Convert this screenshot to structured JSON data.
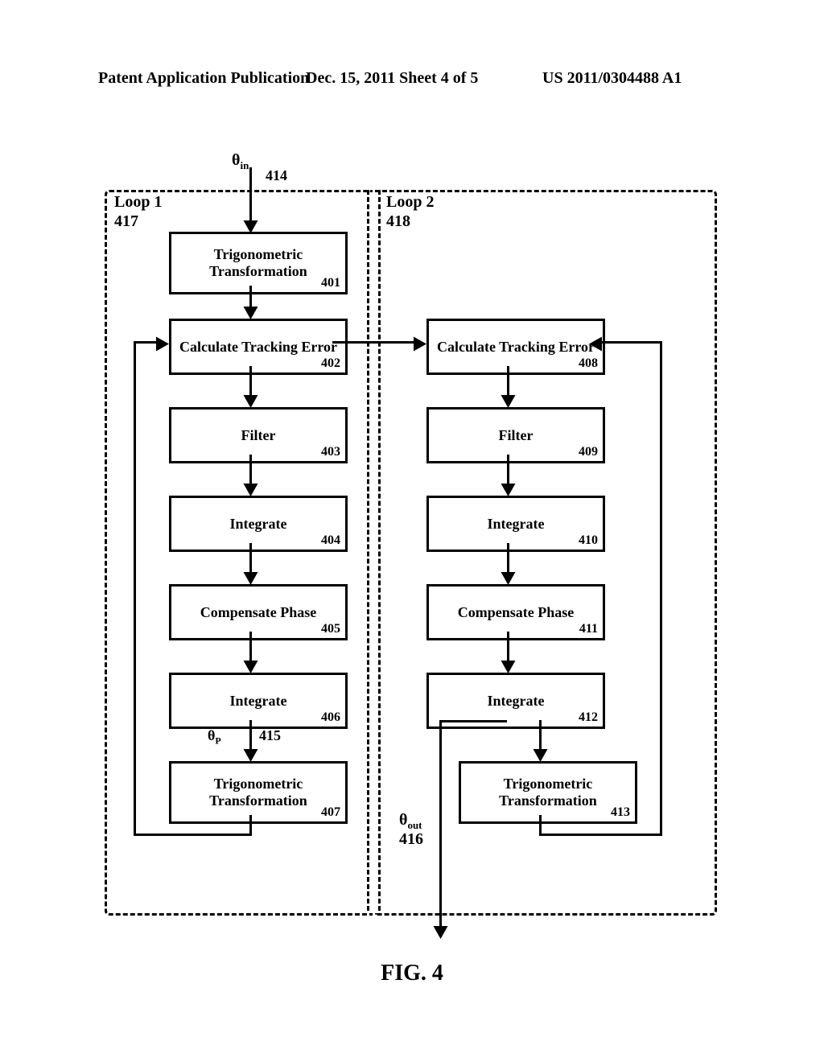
{
  "header": {
    "left": "Patent Application Publication",
    "center": "Dec. 15, 2011  Sheet 4 of 5",
    "right": "US 2011/0304488 A1"
  },
  "figure_caption": "FIG. 4",
  "diagram": {
    "input_label": "θ",
    "input_sub": "in",
    "input_ref": "414",
    "output_label": "θ",
    "output_sub": "out",
    "output_ref": "416",
    "mid_label": "θ",
    "mid_sub": "P",
    "mid_ref": "415",
    "loop1": {
      "title": "Loop 1",
      "ref": "417"
    },
    "loop2": {
      "title": "Loop 2",
      "ref": "418"
    },
    "blocks": {
      "b401": {
        "text": "Trigonometric Transformation",
        "ref": "401"
      },
      "b402": {
        "text": "Calculate Tracking Error",
        "ref": "402"
      },
      "b403": {
        "text": "Filter",
        "ref": "403"
      },
      "b404": {
        "text": "Integrate",
        "ref": "404"
      },
      "b405": {
        "text": "Compensate Phase",
        "ref": "405"
      },
      "b406": {
        "text": "Integrate",
        "ref": "406"
      },
      "b407": {
        "text": "Trigonometric Transformation",
        "ref": "407"
      },
      "b408": {
        "text": "Calculate Tracking Error",
        "ref": "408"
      },
      "b409": {
        "text": "Filter",
        "ref": "409"
      },
      "b410": {
        "text": "Integrate",
        "ref": "410"
      },
      "b411": {
        "text": "Compensate Phase",
        "ref": "411"
      },
      "b412": {
        "text": "Integrate",
        "ref": "412"
      },
      "b413": {
        "text": "Trigonometric Transformation",
        "ref": "413"
      }
    }
  }
}
